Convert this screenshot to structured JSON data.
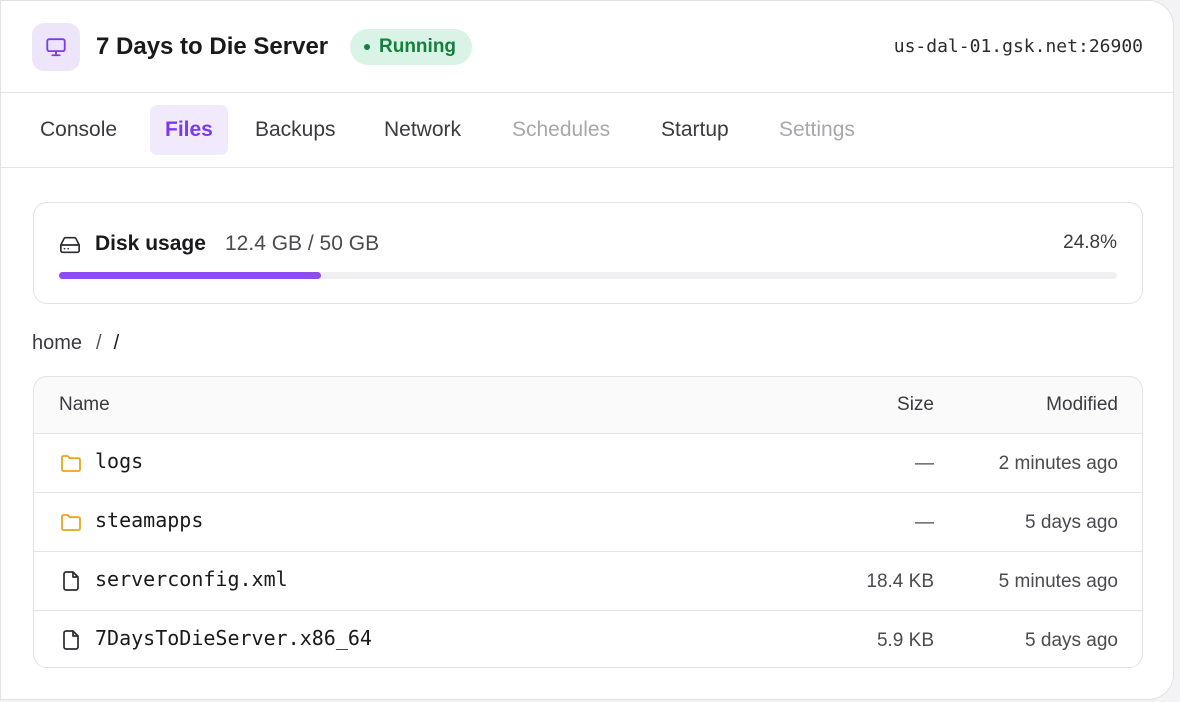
{
  "header": {
    "title": "7 Days to Die Server",
    "status": "Running",
    "address": "us-dal-01.gsk.net:26900",
    "accent_color": "#7c3aed",
    "status_color": "#15803d",
    "icon": "monitor-icon"
  },
  "tabs": [
    {
      "label": "Console",
      "state": "normal"
    },
    {
      "label": "Files",
      "state": "active"
    },
    {
      "label": "Backups",
      "state": "normal"
    },
    {
      "label": "Network",
      "state": "normal"
    },
    {
      "label": "Schedules",
      "state": "disabled"
    },
    {
      "label": "Startup",
      "state": "normal"
    },
    {
      "label": "Settings",
      "state": "disabled"
    }
  ],
  "disk": {
    "label": "Disk usage",
    "amount": "12.4 GB / 50 GB",
    "percent_label": "24.8%",
    "fraction": 0.248,
    "icon": "hard-drive-icon"
  },
  "breadcrumb": {
    "root": "home",
    "separator": "/",
    "current": "/"
  },
  "files": {
    "columns": {
      "name": "Name",
      "size": "Size",
      "modified": "Modified"
    },
    "rows": [
      {
        "name": "logs",
        "size": "—",
        "modified": "2 minutes ago",
        "kind": "folder"
      },
      {
        "name": "steamapps",
        "size": "—",
        "modified": "5 days ago",
        "kind": "folder"
      },
      {
        "name": "serverconfig.xml",
        "size": "18.4 KB",
        "modified": "5 minutes ago",
        "kind": "file"
      },
      {
        "name": "7DaysToDieServer.x86_64",
        "size": "5.9 KB",
        "modified": "5 days ago",
        "kind": "file"
      }
    ]
  }
}
